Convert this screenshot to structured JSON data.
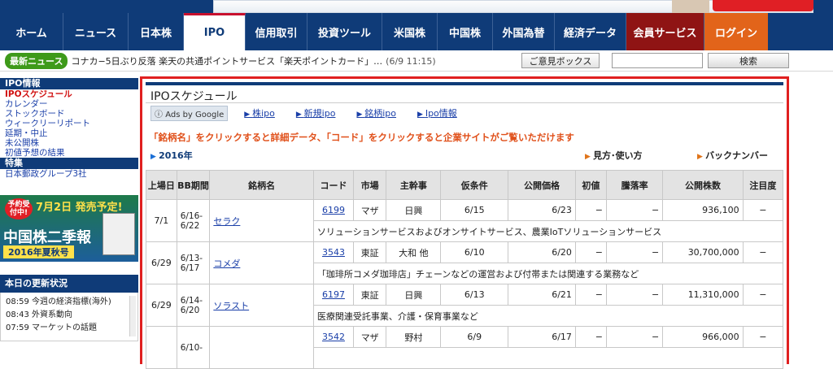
{
  "nav": [
    {
      "label": "ホーム",
      "w": 78
    },
    {
      "label": "ニュース",
      "w": 80
    },
    {
      "label": "日本株",
      "w": 68
    },
    {
      "label": "IPO",
      "w": 76,
      "active": true
    },
    {
      "label": "信用取引",
      "w": 76
    },
    {
      "label": "投資ツール",
      "w": 92
    },
    {
      "label": "米国株",
      "w": 68
    },
    {
      "label": "中国株",
      "w": 68
    },
    {
      "label": "外国為替",
      "w": 76
    },
    {
      "label": "経済データ",
      "w": 88
    },
    {
      "label": "会員サービス",
      "w": 96
    },
    {
      "label": "ログイン",
      "w": 78
    }
  ],
  "newsbar": {
    "badge": "最新ニュース",
    "headline": "コナカ−5日ぶり反落  楽天の共通ポイントサービス「楽天ポイントカード」…",
    "time": "(6/9 11:15)",
    "opinion_label": "ご意見ボックス",
    "search_label": "検索"
  },
  "sidebar": {
    "section1_title": "IPO情報",
    "section1_links": [
      "IPOスケジュール",
      "カレンダー",
      "ストックボード",
      "ウィークリーリポート",
      "延期・中止",
      "未公開株",
      "初値予想の結果"
    ],
    "section2_title": "特集",
    "section2_links": [
      "日本郵政グループ3社"
    ],
    "banner": {
      "badge": "予約受付中!",
      "date": "7月2日 発売予定!",
      "title": "中国株二季報",
      "subtitle": "2016年夏秋号"
    },
    "updates_title": "本日の更新状況",
    "updates": [
      "08:59 今週の経済指標(海外)",
      "08:43 外資系動向",
      "07:59 マーケットの話題"
    ]
  },
  "main": {
    "title": "IPOスケジュール",
    "ads_badge": "Ads by Google",
    "ad_links": [
      "株ipo",
      "新規ipo",
      "銘柄ipo",
      "Ipo情報"
    ],
    "notice": "「銘柄名」をクリックすると詳細データ、「コード」をクリックすると企業サイトがご覧いただけます",
    "year": "2016年",
    "howto": "見方･使い方",
    "backnumber": "バックナンバー",
    "columns": [
      "上場日",
      "BB期間",
      "銘柄名",
      "コード",
      "市場",
      "主幹事",
      "仮条件",
      "公開価格",
      "初値",
      "騰落率",
      "公開株数",
      "注目度"
    ],
    "rows": [
      {
        "date": "7/1",
        "bb": "6/16-\n6/22",
        "name": "セラク",
        "code": "6199",
        "market": "マザ",
        "lead": "日興",
        "cond": "6/15",
        "price": "6/23",
        "first": "−",
        "rate": "−",
        "shares": "936,100",
        "attn": "−",
        "desc": "ソリューションサービスおよびオンサイトサービス、農業IoTソリューションサービス"
      },
      {
        "date": "6/29",
        "bb": "6/13-\n6/17",
        "name": "コメダ",
        "code": "3543",
        "market": "東証",
        "lead": "大和 他",
        "cond": "6/10",
        "price": "6/20",
        "first": "−",
        "rate": "−",
        "shares": "30,700,000",
        "attn": "−",
        "desc": "「珈琲所コメダ珈琲店」チェーンなどの運営および付帯または関連する業務など"
      },
      {
        "date": "6/29",
        "bb": "6/14-\n6/20",
        "name": "ソラスト",
        "code": "6197",
        "market": "東証",
        "lead": "日興",
        "cond": "6/13",
        "price": "6/21",
        "first": "−",
        "rate": "−",
        "shares": "11,310,000",
        "attn": "−",
        "desc": "医療関連受託事業、介護・保育事業など"
      },
      {
        "date": "",
        "bb": "6/10-",
        "name": "",
        "code": "3542",
        "market": "マザ",
        "lead": "野村",
        "cond": "6/9",
        "price": "6/17",
        "first": "−",
        "rate": "−",
        "shares": "966,000",
        "attn": "−",
        "desc": ""
      }
    ],
    "colors": {
      "nav_bg": "#0f3b78",
      "highlight_border": "#e02020",
      "notice": "#e0501a"
    }
  }
}
